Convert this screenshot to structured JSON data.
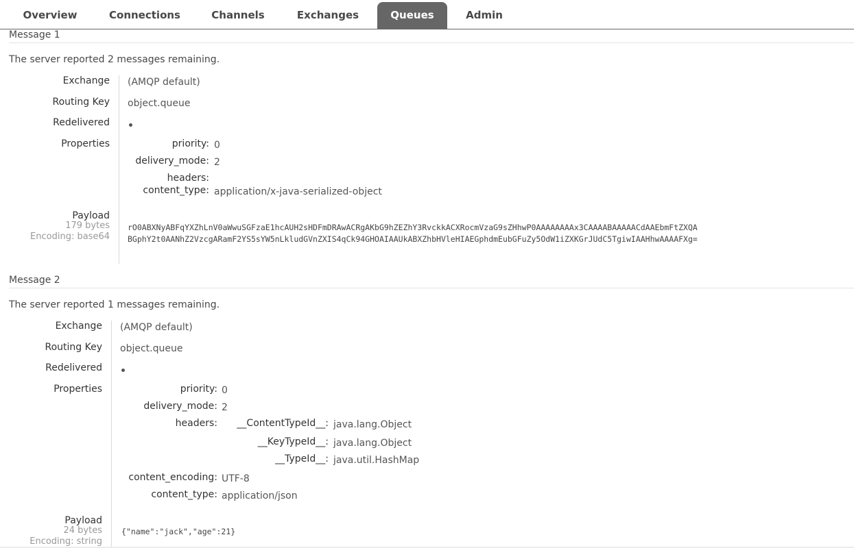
{
  "nav": {
    "tabs": [
      {
        "label": "Overview"
      },
      {
        "label": "Connections"
      },
      {
        "label": "Channels"
      },
      {
        "label": "Exchanges"
      },
      {
        "label": "Queues"
      },
      {
        "label": "Admin"
      }
    ],
    "active": "Queues"
  },
  "labels": {
    "exchange": "Exchange",
    "routing_key": "Routing Key",
    "redelivered": "Redelivered",
    "properties": "Properties",
    "payload": "Payload"
  },
  "messages": [
    {
      "title": "Message 1",
      "remaining_prefix": "The server reported ",
      "remaining_count": "2",
      "remaining_suffix": " messages remaining.",
      "exchange": "(AMQP default)",
      "routing_key": "object.queue",
      "properties": {
        "priority": {
          "key": "priority:",
          "value": "0"
        },
        "delivery_mode": {
          "key": "delivery_mode:",
          "value": "2"
        },
        "headers": {
          "key": "headers:"
        },
        "content_type": {
          "key": "content_type:",
          "value": "application/x-java-serialized-object"
        }
      },
      "payload_size": "179 bytes",
      "payload_encoding": "Encoding: base64",
      "payload_line1": "rO0ABXNyABFqYXZhLnV0aWwuSGFzaE1hcAUH2sHDFmDRAwACRgAKbG9hZEZhY3RvckkACXRocmVzaG9sZHhwP0AAAAAAAAx3CAAAABAAAAACdAAEbmFtZXQA",
      "payload_line2": "BGphY2t0AANhZ2VzcgARamF2YS5sYW5nLkludGVnZXIS4qCk94GHOAIAAUkABXZhbHVleHIAEGphdmEubGFuZy5OdW1iZXKGrJUdC5TgiwIAAHhwAAAAFXg="
    },
    {
      "title": "Message 2",
      "remaining_prefix": "The server reported ",
      "remaining_count": "1",
      "remaining_suffix": " messages remaining.",
      "exchange": "(AMQP default)",
      "routing_key": "object.queue",
      "properties": {
        "priority": {
          "key": "priority:",
          "value": "0"
        },
        "delivery_mode": {
          "key": "delivery_mode:",
          "value": "2"
        },
        "headers": {
          "key": "headers:",
          "entries": [
            {
              "key": "__ContentTypeId__:",
              "value": "java.lang.Object"
            },
            {
              "key": "__KeyTypeId__:",
              "value": "java.lang.Object"
            },
            {
              "key": "__TypeId__:",
              "value": "java.util.HashMap"
            }
          ]
        },
        "content_encoding": {
          "key": "content_encoding:",
          "value": "UTF-8"
        },
        "content_type": {
          "key": "content_type:",
          "value": "application/json"
        }
      },
      "payload_size": "24 bytes",
      "payload_encoding": "Encoding: string",
      "payload_line1": "{\"name\":\"jack\",\"age\":21}"
    }
  ],
  "colors": {
    "active_tab_bg": "#666666",
    "active_tab_text": "#ffffff",
    "text": "#484848",
    "muted": "#999999"
  }
}
